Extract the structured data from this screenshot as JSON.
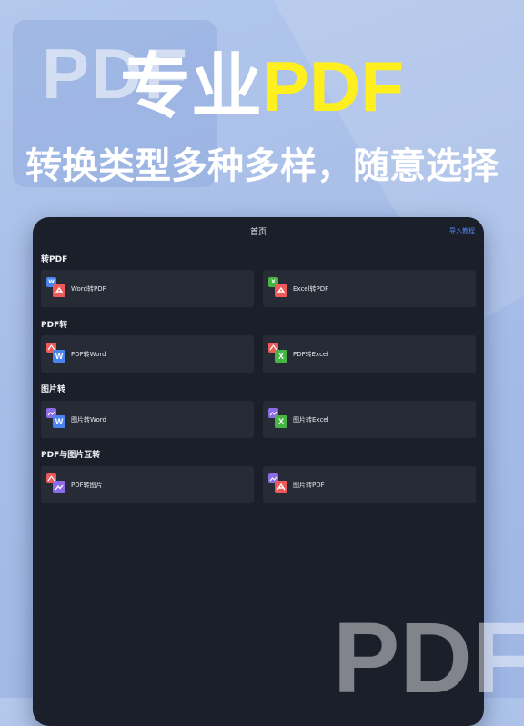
{
  "banner": {
    "headline_main": "专业",
    "headline_accent": "PDF",
    "subtitle": "转换类型多种多样，随意选择",
    "bg_watermark": "PDF",
    "bg_watermark_bottom": "PDF"
  },
  "nav": {
    "title": "首页",
    "link": "导入教程"
  },
  "sections": [
    {
      "title": "转PDF",
      "cards": [
        {
          "label": "Word转PDF",
          "back_icon": "W",
          "back_color": "#4a84ee",
          "front_icon": "pdf-icon",
          "front_color": "#ec5a5a"
        },
        {
          "label": "Excel转PDF",
          "back_icon": "X",
          "back_color": "#46b545",
          "front_icon": "pdf-icon",
          "front_color": "#ec5a5a"
        }
      ]
    },
    {
      "title": "PDF转",
      "cards": [
        {
          "label": "PDF转Word",
          "back_icon": "pdf-icon",
          "back_color": "#ec5a5a",
          "front_icon": "W",
          "front_color": "#4a84ee"
        },
        {
          "label": "PDF转Excel",
          "back_icon": "pdf-icon",
          "back_color": "#ec5a5a",
          "front_icon": "X",
          "front_color": "#46b545"
        }
      ]
    },
    {
      "title": "图片转",
      "cards": [
        {
          "label": "图片转Word",
          "back_icon": "image-icon",
          "back_color": "#8c6be8",
          "front_icon": "W",
          "front_color": "#4a84ee"
        },
        {
          "label": "图片转Excel",
          "back_icon": "image-icon",
          "back_color": "#8c6be8",
          "front_icon": "X",
          "front_color": "#46b545"
        }
      ]
    },
    {
      "title": "PDF与图片互转",
      "cards": [
        {
          "label": "PDF转图片",
          "back_icon": "pdf-icon",
          "back_color": "#ec5a5a",
          "front_icon": "image-icon",
          "front_color": "#8c6be8"
        },
        {
          "label": "图片转PDF",
          "back_icon": "image-icon",
          "back_color": "#8c6be8",
          "front_icon": "pdf-icon",
          "front_color": "#ec5a5a"
        }
      ]
    }
  ],
  "colors": {
    "accent_yellow": "#ffef1f",
    "panel_bg": "#1b1f2a",
    "card_bg": "#272b35",
    "link_blue": "#4e86f0"
  }
}
